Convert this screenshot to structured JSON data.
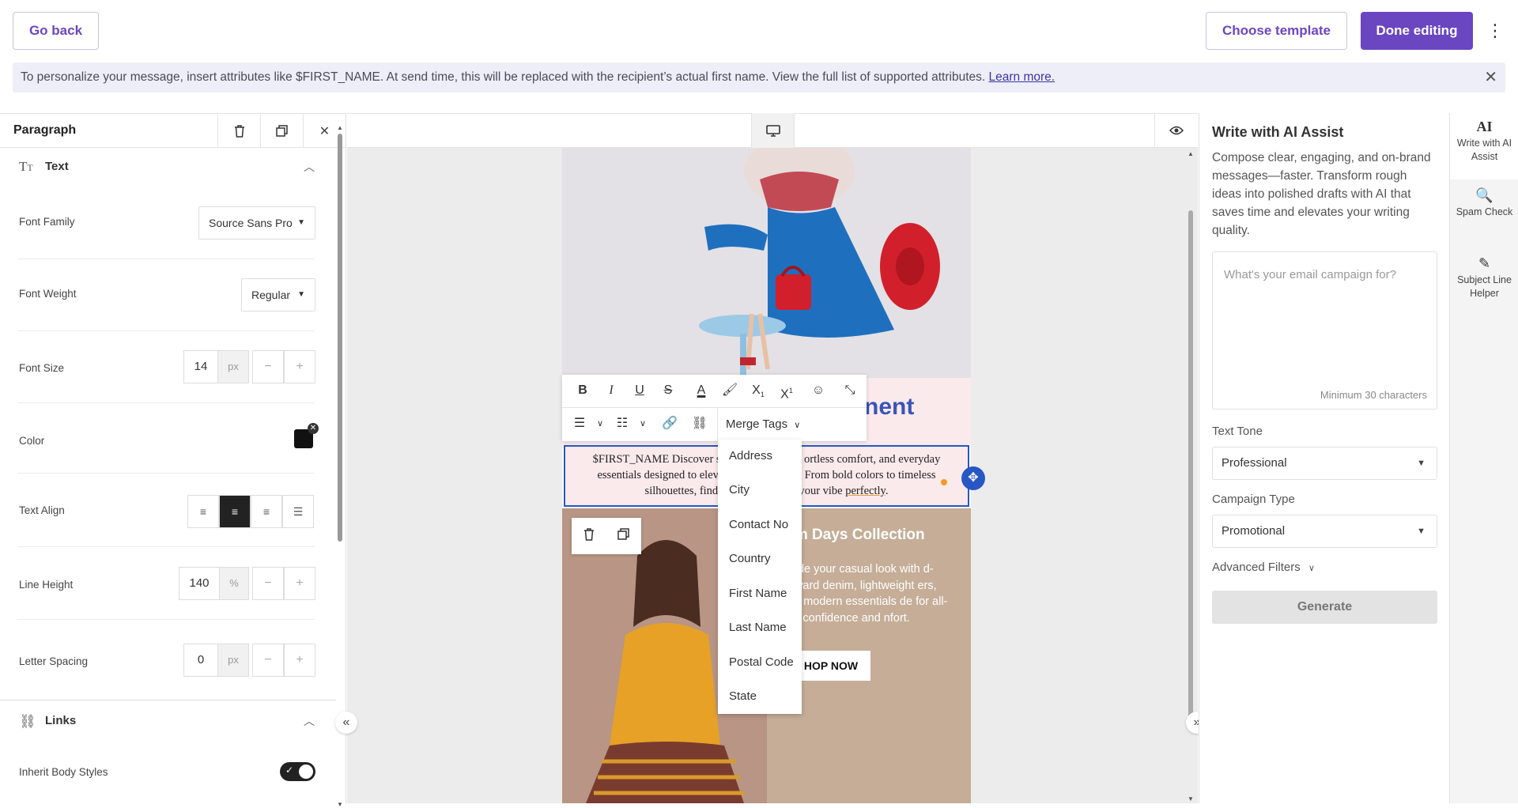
{
  "topbar": {
    "go_back": "Go back",
    "choose_template": "Choose template",
    "done_editing": "Done editing",
    "more": "⋮"
  },
  "banner": {
    "text": "To personalize your message, insert attributes like $FIRST_NAME. At send time, this will be replaced with the recipient’s actual first name. View the full list of supported attributes. ",
    "link": "Learn more.",
    "close": "✕"
  },
  "left_panel": {
    "title": "Paragraph",
    "text_section": "Text",
    "font_family_label": "Font Family",
    "font_family_value": "Source Sans Pro",
    "font_weight_label": "Font Weight",
    "font_weight_value": "Regular",
    "font_size_label": "Font Size",
    "font_size_value": "14",
    "font_size_unit": "px",
    "color_label": "Color",
    "color_value": "#111111",
    "text_align_label": "Text Align",
    "line_height_label": "Line Height",
    "line_height_value": "140",
    "line_height_unit": "%",
    "letter_spacing_label": "Letter Spacing",
    "letter_spacing_value": "0",
    "letter_spacing_unit": "px",
    "links_section": "Links",
    "inherit_label": "Inherit Body Styles"
  },
  "email": {
    "heading_fragment": "nent",
    "paragraph_line1_a": "$FIRST_NAME Discover sta",
    "paragraph_line1_b": "ortless comfort, and everyday",
    "paragraph_line2_a": "essentials designed to elev",
    "paragraph_line2_b": "e. From bold colors to timeless",
    "paragraph_line3_a": "silhouettes, find ",
    "paragraph_line3_b": " your vibe ",
    "paragraph_underlined": "perfectly",
    "paragraph_end": ".",
    "block2_title": "nim Days Collection",
    "block2_body": "grade your casual look with d-forward denim, lightweight ers, and modern essentials de for all-day confidence and nfort.",
    "shop_button": "HOP NOW"
  },
  "toolbar": {
    "merge_tags": "Merge Tags",
    "merge_options": [
      "Address",
      "City",
      "Contact No",
      "Country",
      "First Name",
      "Last Name",
      "Postal Code",
      "State"
    ]
  },
  "ai_panel": {
    "title": "Write with AI Assist",
    "description": "Compose clear, engaging, and on-brand messages—faster. Transform rough ideas into polished drafts with AI that saves time and elevates your writing quality.",
    "placeholder": "What's your email campaign for?",
    "min_chars": "Minimum 30 characters",
    "tone_label": "Text Tone",
    "tone_value": "Professional",
    "campaign_label": "Campaign Type",
    "campaign_value": "Promotional",
    "advanced_filters": "Advanced Filters",
    "generate": "Generate"
  },
  "rail": {
    "write_ai": "Write with AI Assist",
    "spam_check": "Spam Check",
    "subject_helper": "Subject Line Helper"
  }
}
